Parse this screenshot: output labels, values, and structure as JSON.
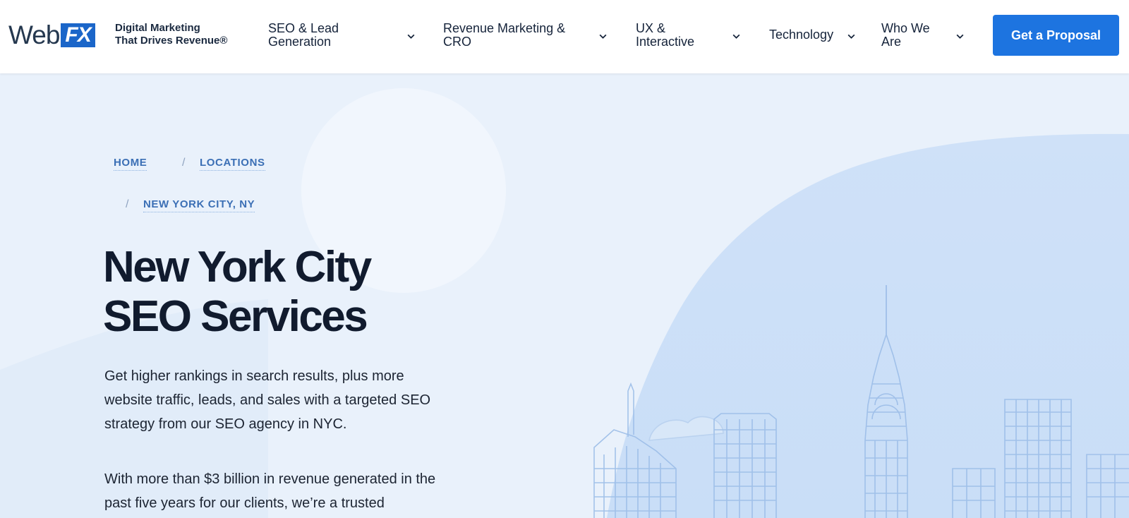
{
  "header": {
    "logo": {
      "web": "Web",
      "fx": "FX"
    },
    "tagline": {
      "line1": "Digital Marketing",
      "line2": "That Drives Revenue®"
    },
    "nav": [
      {
        "line1": "SEO & Lead",
        "line2": "Generation"
      },
      {
        "line1": "Revenue Marketing &",
        "line2": "CRO"
      },
      {
        "line1": "UX &",
        "line2": "Interactive"
      },
      {
        "line1": "Technology",
        "line2": ""
      },
      {
        "line1": "Who We",
        "line2": "Are"
      }
    ],
    "cta_label": "Get a Proposal"
  },
  "breadcrumb": {
    "home": "HOME",
    "locations": "LOCATIONS",
    "current": "NEW YORK CITY, NY",
    "separator": "/"
  },
  "hero": {
    "title_line1": "New York City",
    "title_line2": "SEO Services",
    "paragraph1": "Get higher rankings in search results, plus more website traffic, leads, and sales with a targeted SEO strategy from our SEO agency in NYC.",
    "paragraph2": "With more than $3 billion in revenue generated in the past five years for our clients, we’re a trusted"
  },
  "colors": {
    "accent": "#1d74e0",
    "brand_blue": "#1b66c9",
    "breadcrumb": "#3b6fb5",
    "hero_bg": "#e9f1fb",
    "title": "#111b2e"
  },
  "icons": {
    "nav_chevron": "chevron-down-icon"
  }
}
